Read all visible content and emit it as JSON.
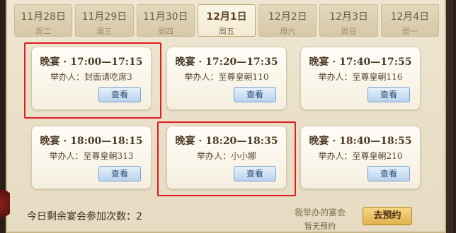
{
  "tabs": [
    {
      "date": "11月28日",
      "weekday": "周二",
      "active": false
    },
    {
      "date": "11月29日",
      "weekday": "周三",
      "active": false
    },
    {
      "date": "11月30日",
      "weekday": "周四",
      "active": false
    },
    {
      "date": "12月1日",
      "weekday": "周五",
      "active": true
    },
    {
      "date": "12月2日",
      "weekday": "周六",
      "active": false
    },
    {
      "date": "12月3日",
      "weekday": "周日",
      "active": false
    },
    {
      "date": "12月4日",
      "weekday": "周一",
      "active": false
    }
  ],
  "cards": [
    {
      "title": "晚宴 · 17:00—17:15",
      "host": "举办人：封面请吃席3",
      "button": "查看",
      "highlighted": true
    },
    {
      "title": "晚宴 · 17:20—17:35",
      "host": "举办人：至尊皇朝110",
      "button": "查看",
      "highlighted": false
    },
    {
      "title": "晚宴 · 17:40—17:55",
      "host": "举办人：至尊皇朝116",
      "button": "查看",
      "highlighted": false
    },
    {
      "title": "晚宴 · 18:00—18:15",
      "host": "举办人：至尊皇朝313",
      "button": "查看",
      "highlighted": false
    },
    {
      "title": "晚宴 · 18:20—18:35",
      "host": "举办人：小小娜",
      "button": "查看",
      "highlighted": true
    },
    {
      "title": "晚宴 · 18:40—18:55",
      "host": "举办人：至尊皇朝210",
      "button": "查看",
      "highlighted": false
    }
  ],
  "footer": {
    "remaining_label": "今日剩余宴会参加次数：",
    "remaining_count": "2",
    "my_banquet_label": "我举办的宴会",
    "my_banquet_status": "暂无预约",
    "reserve_button": "去预约"
  },
  "colors": {
    "highlight": "#e21c1c",
    "view_button": "#b9d3ee",
    "reserve_button": "#e2b24f"
  }
}
